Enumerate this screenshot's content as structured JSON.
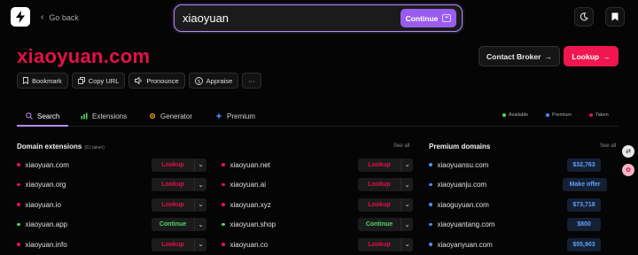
{
  "header": {
    "back_label": "Go back",
    "search_value": "xiaoyuan",
    "continue_label": "Continue",
    "kbd_glyph": "↵"
  },
  "domain": {
    "title": "xiaoyuan.com",
    "contact_label": "Contact Broker",
    "lookup_label": "Lookup",
    "arrow": "→"
  },
  "actions": [
    {
      "label": "Bookmark",
      "icon": "bookmark-icon"
    },
    {
      "label": "Copy URL",
      "icon": "copy-icon"
    },
    {
      "label": "Pronounce",
      "icon": "speaker-icon"
    },
    {
      "label": "Appraise",
      "icon": "dollar-icon"
    },
    {
      "label": "···",
      "icon": "more-icon"
    }
  ],
  "tabs": [
    {
      "label": "Search",
      "icon": "search-icon",
      "active": true
    },
    {
      "label": "Extensions",
      "icon": "chart-icon",
      "active": false
    },
    {
      "label": "Generator",
      "icon": "gear-icon",
      "active": false
    },
    {
      "label": "Premium",
      "icon": "sparkle-icon",
      "active": false
    }
  ],
  "legend": [
    {
      "label": "Available",
      "color": "#4cd964"
    },
    {
      "label": "Premium",
      "color": "#4a8cff"
    },
    {
      "label": "Taken",
      "color": "#e5104a"
    }
  ],
  "extensions": {
    "title": "Domain extensions",
    "count_note": "(61 taken)",
    "see_all": "See all",
    "col1": [
      {
        "name": "xiaoyuan.com",
        "status": "taken",
        "action": "Lookup"
      },
      {
        "name": "xiaoyuan.org",
        "status": "taken",
        "action": "Lookup"
      },
      {
        "name": "xiaoyuan.io",
        "status": "taken",
        "action": "Lookup"
      },
      {
        "name": "xiaoyuan.app",
        "status": "available",
        "action": "Continue"
      },
      {
        "name": "xiaoyuan.info",
        "status": "taken",
        "action": "Lookup"
      }
    ],
    "col2": [
      {
        "name": "xiaoyuan.net",
        "status": "taken",
        "action": "Lookup"
      },
      {
        "name": "xiaoyuan.ai",
        "status": "taken",
        "action": "Lookup"
      },
      {
        "name": "xiaoyuan.xyz",
        "status": "taken",
        "action": "Lookup"
      },
      {
        "name": "xiaoyuan.shop",
        "status": "available",
        "action": "Continue"
      },
      {
        "name": "xiaoyuan.co",
        "status": "taken",
        "action": "Lookup"
      }
    ]
  },
  "premium": {
    "title": "Premium domains",
    "see_all": "See all",
    "items": [
      {
        "name": "xiaoyuansu.com",
        "price": "$32,763"
      },
      {
        "name": "xiaoyuanju.com",
        "price": "Make offer"
      },
      {
        "name": "xiaoguyuan.com",
        "price": "$73,718"
      },
      {
        "name": "xiaoyuantang.com",
        "price": "$800"
      },
      {
        "name": "xiaoyanyuan.com",
        "price": "$55,903"
      }
    ]
  },
  "colors": {
    "taken": "#e5104a",
    "available": "#4cd964",
    "premium": "#4a8cff",
    "accent": "#b48cf5"
  }
}
